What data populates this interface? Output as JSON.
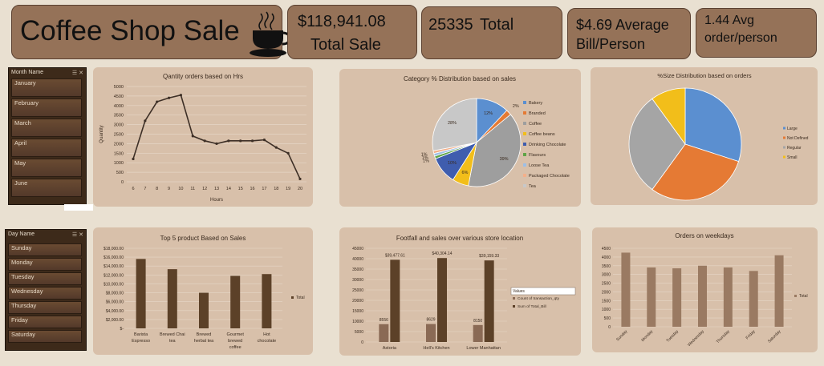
{
  "dashboard": {
    "title": "Coffee Shop Sale"
  },
  "kpis": [
    {
      "value": "$118,941.08",
      "label": "Total Sale"
    },
    {
      "value": "25335",
      "label": "Total"
    },
    {
      "value": "$4.69",
      "label": "Average Bill/Person"
    },
    {
      "value": "1.44 Avg",
      "label": "order/person"
    }
  ],
  "slicers": {
    "month": {
      "header": "Month Name",
      "items": [
        "January",
        "February",
        "March",
        "April",
        "May",
        "June"
      ]
    },
    "day": {
      "header": "Day Name",
      "items": [
        "Sunday",
        "Monday",
        "Tuesday",
        "Wednesday",
        "Thursday",
        "Friday",
        "Saturday"
      ]
    }
  },
  "colors": {
    "background": "#e9e0d1",
    "card": "#957258",
    "panel": "#d8c0aa",
    "bar": "#5c4128",
    "bar_light": "#9a7a62"
  },
  "chart_data": [
    {
      "id": "hours",
      "type": "line",
      "title": "Qantity orders based on Hrs",
      "xlabel": "Hours",
      "ylabel": "Quantity",
      "x": [
        6,
        7,
        8,
        9,
        10,
        11,
        12,
        13,
        14,
        15,
        16,
        17,
        18,
        19,
        20
      ],
      "values": [
        1200,
        3200,
        4200,
        4400,
        4550,
        2400,
        2150,
        2000,
        2150,
        2150,
        2150,
        2200,
        1800,
        1500,
        150
      ],
      "ylim": [
        0,
        5000
      ],
      "yticks": [
        0,
        500,
        1000,
        1500,
        2000,
        2500,
        3000,
        3500,
        4000,
        4500,
        5000
      ],
      "grid": true
    },
    {
      "id": "category",
      "type": "pie",
      "title": "Category % Distribution based on sales",
      "categories": [
        "Bakery",
        "Branded",
        "Coffee",
        "Coffee beans",
        "Drinking Chocolate",
        "Flavours",
        "Loose Tea",
        "Packaged Chocolate",
        "Tea"
      ],
      "values": [
        12,
        2,
        39,
        6,
        10,
        1,
        1,
        1,
        28
      ],
      "labels": [
        "12%",
        "2%",
        "39%",
        "6%",
        "10%",
        "1%",
        "1%",
        "1%",
        "28%"
      ],
      "colors": [
        "#5b8fd0",
        "#e57a34",
        "#9e9e9e",
        "#f2be1a",
        "#3f5dae",
        "#5fa446",
        "#9dbfe6",
        "#f3b08a",
        "#c8c8c8"
      ],
      "legend": "right"
    },
    {
      "id": "size",
      "type": "pie",
      "title": "%Size Distribution based on orders",
      "categories": [
        "Large",
        "Not Defined",
        "Regular",
        "Small"
      ],
      "values": [
        30,
        30,
        30,
        10
      ],
      "colors": [
        "#5b8fd0",
        "#e57a34",
        "#a5a5a5",
        "#f2be1a"
      ],
      "legend": "right"
    },
    {
      "id": "top5",
      "type": "bar",
      "title": "Top 5 product Based on Sales",
      "categories": [
        "Barista Espresso",
        "Brewed Chai tea",
        "Brewed herbal tea",
        "Gourmet brewed coffee",
        "Hot chocolate"
      ],
      "values": [
        15600,
        13300,
        8000,
        11800,
        12200
      ],
      "ylim": [
        0,
        18000
      ],
      "yticks": [
        "$-",
        "$2,000.00",
        "$4,000.00",
        "$6,000.00",
        "$8,000.00",
        "$10,000.00",
        "$12,000.00",
        "$14,000.00",
        "$16,000.00",
        "$18,000.00"
      ],
      "legend": [
        "Total"
      ],
      "grid": true
    },
    {
      "id": "footfall",
      "type": "bar",
      "title": "Footfall and sales over various store location",
      "categories": [
        "Astoria",
        "Hell's Kitchen",
        "Lower Manhattan"
      ],
      "series": [
        {
          "name": "Count of transaction_qty",
          "values": [
            8556,
            8629,
            8150
          ],
          "labels": [
            "8556",
            "8629",
            "8150"
          ],
          "color": "#8a6a55"
        },
        {
          "name": "Sum of Total_Bill",
          "values": [
            39477.61,
            40304.14,
            39159.33
          ],
          "labels": [
            "$39,477.61",
            "$40,304.14",
            "$39,159.33"
          ],
          "color": "#5c4128"
        }
      ],
      "ylim": [
        0,
        45000
      ],
      "yticks": [
        0,
        5000,
        10000,
        15000,
        20000,
        25000,
        30000,
        35000,
        40000,
        45000
      ],
      "legend_title": "Values",
      "grid": true
    },
    {
      "id": "weekdays",
      "type": "bar",
      "title": "Orders on weekdays",
      "categories": [
        "Sunday",
        "Monday",
        "Tuesday",
        "Wednesday",
        "Thursday",
        "Friday",
        "Saturday"
      ],
      "values": [
        4250,
        3400,
        3350,
        3500,
        3400,
        3200,
        4100
      ],
      "ylim": [
        0,
        4500
      ],
      "yticks": [
        0,
        500,
        1000,
        1500,
        2000,
        2500,
        3000,
        3500,
        4000,
        4500
      ],
      "legend": [
        "Total"
      ],
      "grid": true
    }
  ]
}
